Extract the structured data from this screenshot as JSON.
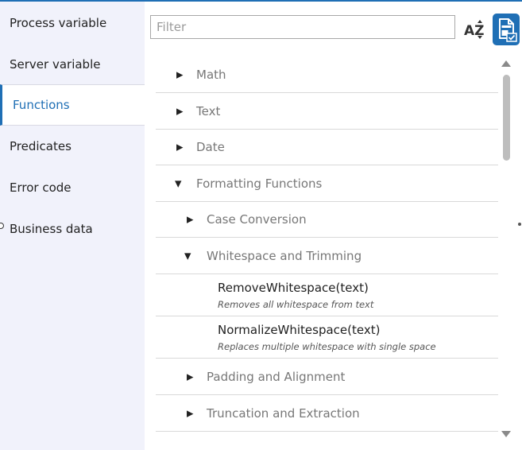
{
  "sidebar": {
    "items": [
      {
        "label": "Process variable",
        "active": false
      },
      {
        "label": "Server variable",
        "active": false
      },
      {
        "label": "Functions",
        "active": true
      },
      {
        "label": "Predicates",
        "active": false
      },
      {
        "label": "Error code",
        "active": false
      },
      {
        "label": "Business data",
        "active": false
      }
    ]
  },
  "toolbar": {
    "filter_placeholder": "Filter",
    "filter_value": "",
    "sort_label": "AZ",
    "sort_icon": "sort-az-icon",
    "insert_icon": "document-check-icon"
  },
  "tree": {
    "nodes": [
      {
        "label": "Math",
        "expanded": false
      },
      {
        "label": "Text",
        "expanded": false
      },
      {
        "label": "Date",
        "expanded": false
      },
      {
        "label": "Formatting Functions",
        "expanded": true
      },
      {
        "label": "Case Conversion",
        "expanded": false
      },
      {
        "label": "Whitespace and Trimming",
        "expanded": true
      },
      {
        "name": "RemoveWhitespace(text)",
        "description": "Removes all whitespace from text"
      },
      {
        "name": "NormalizeWhitespace(text)",
        "description": "Replaces multiple whitespace with single space"
      },
      {
        "label": "Padding and Alignment",
        "expanded": false
      },
      {
        "label": "Truncation and Extraction",
        "expanded": false
      }
    ]
  },
  "colors": {
    "accent": "#1f6fb5",
    "sidebar_bg": "#f1f2fb",
    "divider": "#d9d9d9",
    "muted_text": "#777777"
  }
}
